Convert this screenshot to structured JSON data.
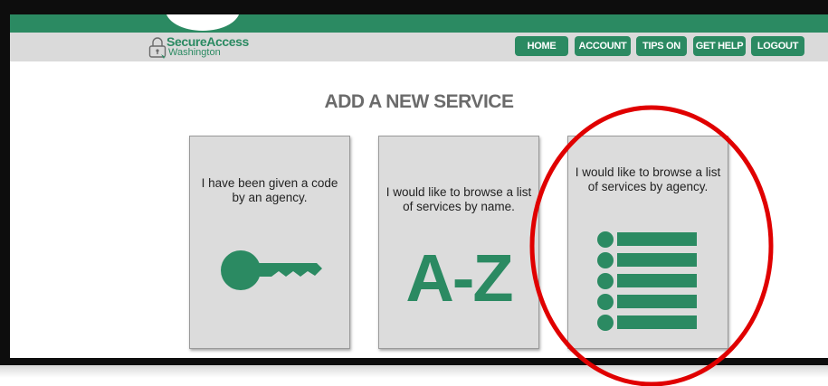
{
  "header": {
    "logo": {
      "brand": "SecureAccess",
      "subtitle": "Washington"
    },
    "nav": [
      "HOME",
      "ACCOUNT",
      "TIPS ON",
      "GET HELP",
      "LOGOUT"
    ]
  },
  "main": {
    "title": "ADD A NEW SERVICE",
    "cards": [
      {
        "text": "I have been given a code by an agency.",
        "icon": "key-icon"
      },
      {
        "text": "I would like to browse a list of services by name.",
        "icon": "a-z-icon",
        "icon_text": "A-Z"
      },
      {
        "text": "I would like to browse a list of services by agency.",
        "icon": "list-icon",
        "highlighted": true
      }
    ]
  },
  "colors": {
    "accent": "#2b8a62",
    "highlight": "#e00000",
    "card": "#dcdcdc",
    "nav_strip": "#dadada"
  }
}
